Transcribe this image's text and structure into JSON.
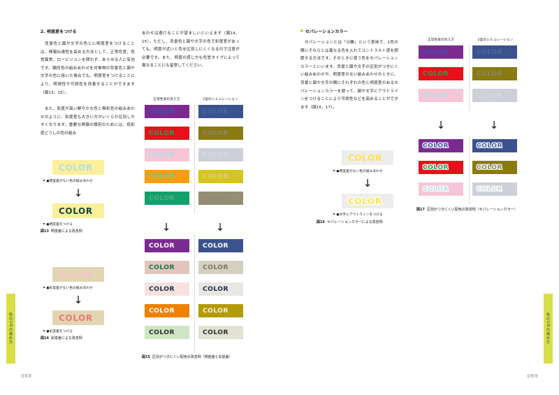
{
  "spread": {
    "left_page_number": "068",
    "right_page_number": "069",
    "edge_tab_label": "色のUDの進め方"
  },
  "left_page": {
    "section_heading": "2. 明度差をつける",
    "paragraph_1": "　背景色と図や文字の色とに明度差をつけることは、情報伝達性を高める方法として、正常色覚、色覚異常、ロービジョンを問わず、あらゆる人に有効です。類同色の組みあわせを対象物の背景色と図や文字の色に用いた場合でも、明度差をつけることにより、明視性や可読性を改善することができます（図13、15）。",
    "paragraph_2": "　また、彩度が高い鮮やかな色と無彩色の組みあわせのように、彩度差も大きい方がいくらか区別しやすくなります。重要な情報の識別のためには、低彩度どうしの色の組み",
    "paragraph_3": "あわせは避けることが望ましいといえます（図14、15）。ただし、背景色と図や文字の色で彩度差があっても、明度が近いと色を区別しにくくなるので注意が必要です。また、明度の感じ方も色覚タイプによって異なることにも留意してください。",
    "fig13": {
      "before_label": "●明度差がない色の組みあわせ",
      "after_label": "●明度差をつける",
      "caption_num": "図13",
      "caption_text": "明度差による改善例",
      "before": {
        "bg": "#fbef9a",
        "fg": "#b7dde2",
        "text": "COLOR"
      },
      "after": {
        "bg": "#fbef9a",
        "fg": "#14453e",
        "text": "COLOR"
      }
    },
    "fig14": {
      "before_label": "●彩度差がない色の組みあわせ",
      "after_label": "●彩度差をつける",
      "caption_num": "図14",
      "caption_text": "彩度差による改善例",
      "before": {
        "bg": "#e2d5b4",
        "fg": "#f3c3c7",
        "text": "COLOR"
      },
      "after": {
        "bg": "#e2d5b4",
        "fg": "#ec7a72",
        "text": "COLOR"
      }
    }
  },
  "middle_figure": {
    "col_head_normal": "正常色覚の見え方",
    "col_head_sim": "2型のシミュレーション",
    "caption_num": "図15",
    "caption_text": "区別がつきにくい配色の改善例（明度差と彩度差）",
    "before_normal": [
      {
        "bg": "#7b2b8f",
        "fg": "#3f4fb0",
        "text": "COLOR"
      },
      {
        "bg": "#e8101b",
        "fg": "#16a84a",
        "text": "COLOR"
      },
      {
        "bg": "#f6c6d8",
        "fg": "#b4dde3",
        "text": "COLOR"
      },
      {
        "bg": "#f79d0e",
        "fg": "#7ecb8a",
        "text": "COLOR"
      },
      {
        "bg": "#14a06a",
        "fg": "#5aa68c",
        "text": "COLOR"
      }
    ],
    "before_sim": [
      {
        "bg": "#3b538d",
        "fg": "#4a66a8",
        "text": "COLOR"
      },
      {
        "bg": "#8a7a10",
        "fg": "#8c8472",
        "text": "COLOR"
      },
      {
        "bg": "#cdd0d8",
        "fg": "#d4dadf",
        "text": "COLOR"
      },
      {
        "bg": "#d6c51b",
        "fg": "#d9d27a",
        "text": "COLOR"
      },
      {
        "bg": "#958e72",
        "fg": "#8e8c7e",
        "text": "COLOR"
      }
    ],
    "after_normal": [
      {
        "bg": "#7b2b8f",
        "fg": "#ffffff",
        "text": "COLOR"
      },
      {
        "bg": "#e5c4bd",
        "fg": "#0d7a43",
        "text": "COLOR"
      },
      {
        "bg": "#f8e2df",
        "fg": "#132f46",
        "text": "COLOR"
      },
      {
        "bg": "#f08000",
        "fg": "#ffffff",
        "text": "COLOR"
      },
      {
        "bg": "#cfe6c4",
        "fg": "#2e2e2e",
        "text": "COLOR"
      }
    ],
    "after_sim": [
      {
        "bg": "#3b538d",
        "fg": "#ffffff",
        "text": "COLOR"
      },
      {
        "bg": "#d4d0c0",
        "fg": "#7b7763",
        "text": "COLOR"
      },
      {
        "bg": "#e8e7e2",
        "fg": "#1d2c4a",
        "text": "COLOR"
      },
      {
        "bg": "#b39b08",
        "fg": "#f5f0d8",
        "text": "COLOR"
      },
      {
        "bg": "#e2e2d2",
        "fg": "#2e2e2e",
        "text": "COLOR"
      }
    ]
  },
  "right_page": {
    "section_heading": "セパレーションカラー",
    "paragraph_1": "　セパレーションとは「分離」という意味で、2色の間にそれらとは異なる色を入れてコントラスト感を調節する方法です。そのときに使う色をセパレーションカラーといいます。背景と図や文字の区別がつきにくい組みあわせや、明度差のない組みあわせのときに、背景と図や文字の間にそれぞれの色と明度差のあるセパレーションカラーを使って、図や文字にアウトラインをつけることにより可読性などを高めることができます（図16、17）。",
    "fig16": {
      "before_label": "●明度差がない色の組みあわせ",
      "after_label": "●文字にアウトラインをつける",
      "caption_num": "図16",
      "caption_text": "セパレーションカラーによる改善例",
      "before": {
        "bg": "#ededed",
        "fg": "#fbe44c",
        "text": "COLOR"
      },
      "after": {
        "bg": "#ededed",
        "fg": "#fbe44c",
        "outline": "#ffffff",
        "text": "COLOR"
      }
    },
    "fig17": {
      "col_head_normal": "正常色覚の見え方",
      "col_head_sim": "2型のシミュレーション",
      "caption_num": "図17",
      "caption_text": "区別がつきにくい配色の改善例（セパレーションカラー）",
      "before_normal": [
        {
          "bg": "#7b2b8f",
          "fg": "#3f4fb0",
          "text": "COLOR"
        },
        {
          "bg": "#e8101b",
          "fg": "#16a84a",
          "text": "COLOR"
        },
        {
          "bg": "#f6c6d8",
          "fg": "#b4dde3",
          "text": "COLOR"
        }
      ],
      "before_sim": [
        {
          "bg": "#3b538d",
          "fg": "#4a66a8",
          "text": "COLOR"
        },
        {
          "bg": "#8a7a10",
          "fg": "#8c8472",
          "text": "COLOR"
        },
        {
          "bg": "#cdd0d8",
          "fg": "#d4dadf",
          "text": "COLOR"
        }
      ],
      "after_normal": [
        {
          "bg": "#7b2b8f",
          "fg": "#3f4fb0",
          "outline": "#ffffff",
          "text": "COLOR"
        },
        {
          "bg": "#e8101b",
          "fg": "#16a84a",
          "outline": "#ffffff",
          "text": "COLOR"
        },
        {
          "bg": "#f6c6d8",
          "fg": "#b4dde3",
          "outline": "#ffffff",
          "text": "COLOR"
        }
      ],
      "after_sim": [
        {
          "bg": "#3b538d",
          "fg": "#4a66a8",
          "outline": "#ffffff",
          "text": "COLOR"
        },
        {
          "bg": "#8a7a10",
          "fg": "#8c8472",
          "outline": "#ffffff",
          "text": "COLOR"
        },
        {
          "bg": "#cdd0d8",
          "fg": "#d4dadf",
          "outline": "#ffffff",
          "text": "COLOR"
        }
      ]
    }
  },
  "icons": {
    "down_arrow": "↓"
  }
}
